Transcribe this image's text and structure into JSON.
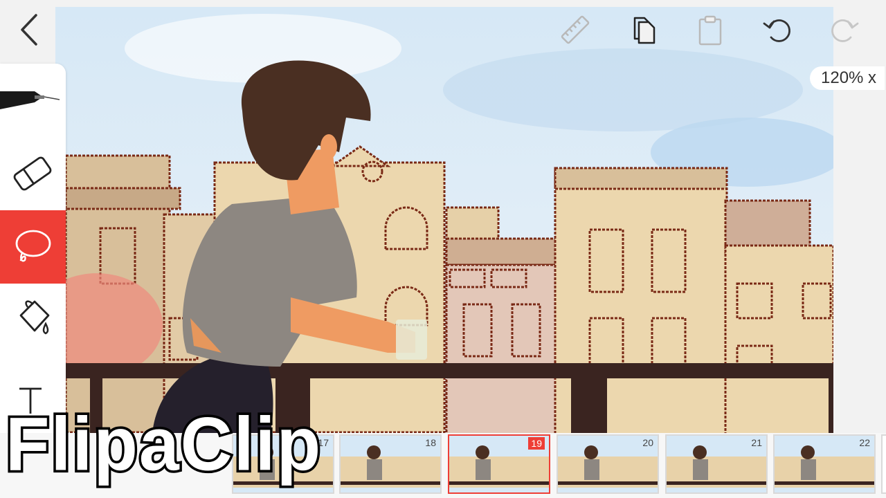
{
  "app": {
    "name": "FlipaClip"
  },
  "topbar": {
    "icons": [
      "back-chevron-icon",
      "ruler-icon",
      "copy-icon",
      "paste-icon",
      "undo-icon",
      "redo-icon"
    ]
  },
  "zoom": {
    "label": "120% x"
  },
  "toolbar": {
    "tools": [
      {
        "name": "brush",
        "icon": "brush-pen-icon"
      },
      {
        "name": "eraser",
        "icon": "eraser-icon"
      },
      {
        "name": "lasso",
        "icon": "lasso-icon",
        "active": true
      },
      {
        "name": "fill",
        "icon": "paint-bucket-icon"
      },
      {
        "name": "text",
        "icon": "text-icon"
      }
    ]
  },
  "timeline": {
    "frames": [
      {
        "number": "17"
      },
      {
        "number": "18"
      },
      {
        "number": "19",
        "selected": true
      },
      {
        "number": "20"
      },
      {
        "number": "21"
      },
      {
        "number": "22"
      }
    ]
  },
  "watermark": {
    "text": "FlipaClip"
  },
  "colors": {
    "accent": "#ee3e36",
    "sky": "#cfe4f4",
    "building": "#e7d2aa",
    "outline": "#7a2a16",
    "railing": "#3a2420"
  }
}
